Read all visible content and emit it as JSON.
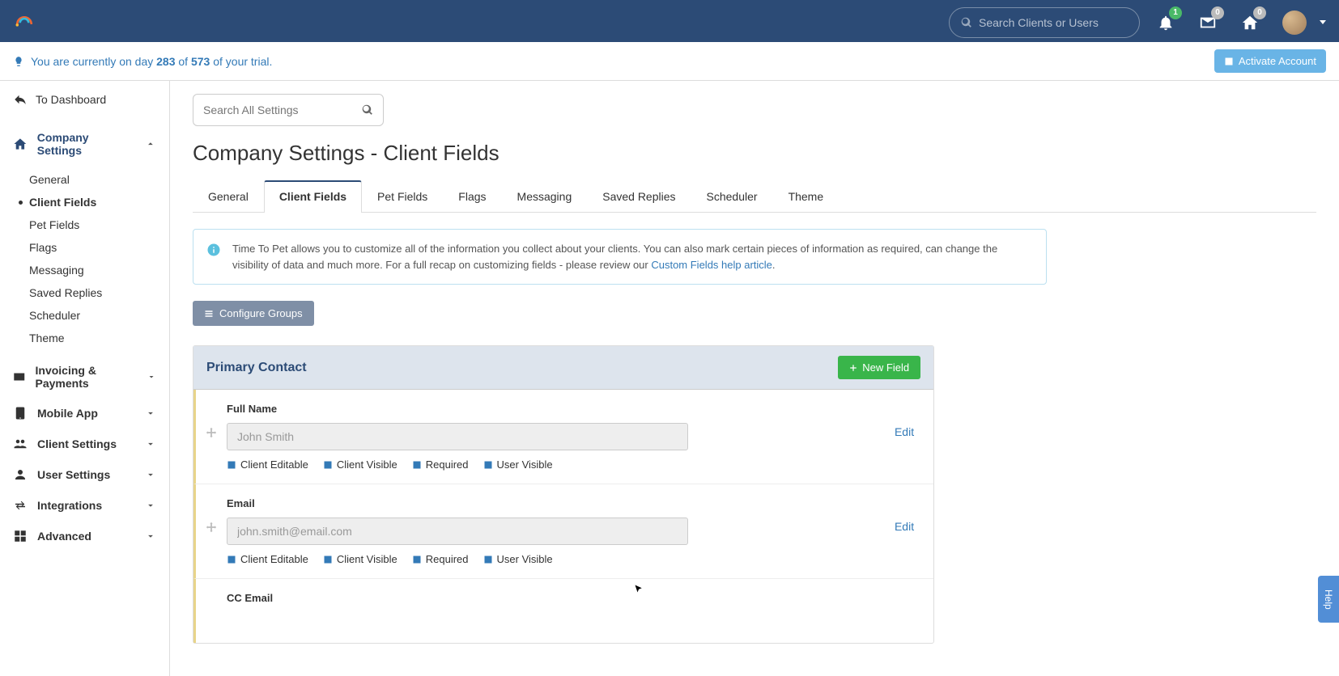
{
  "header": {
    "search_placeholder": "Search Clients or Users",
    "badges": {
      "bell": "1",
      "mail": "0",
      "home": "0"
    }
  },
  "trial": {
    "prefix": "You are currently on day ",
    "day": "283",
    "mid": " of ",
    "total": "573",
    "suffix": " of your trial.",
    "activate_label": "Activate Account"
  },
  "sidebar": {
    "back": "To Dashboard",
    "items": [
      {
        "label": "Company Settings",
        "expanded": true,
        "sub": [
          {
            "label": "General"
          },
          {
            "label": "Client Fields",
            "active": true
          },
          {
            "label": "Pet Fields"
          },
          {
            "label": "Flags"
          },
          {
            "label": "Messaging"
          },
          {
            "label": "Saved Replies"
          },
          {
            "label": "Scheduler"
          },
          {
            "label": "Theme"
          }
        ]
      },
      {
        "label": "Invoicing & Payments"
      },
      {
        "label": "Mobile App"
      },
      {
        "label": "Client Settings"
      },
      {
        "label": "User Settings"
      },
      {
        "label": "Integrations"
      },
      {
        "label": "Advanced"
      }
    ]
  },
  "main": {
    "search_placeholder": "Search All Settings",
    "title": "Company Settings - Client Fields",
    "tabs": [
      "General",
      "Client Fields",
      "Pet Fields",
      "Flags",
      "Messaging",
      "Saved Replies",
      "Scheduler",
      "Theme"
    ],
    "active_tab": "Client Fields",
    "info_text": "Time To Pet allows you to customize all of the information you collect about your clients. You can also mark certain pieces of information as required, can change the visibility of data and much more. For a full recap on customizing fields - please review our ",
    "info_link": "Custom Fields help article",
    "info_period": ".",
    "configure_groups": "Configure Groups",
    "panel": {
      "title": "Primary Contact",
      "new_field": "New Field",
      "fields": [
        {
          "label": "Full Name",
          "placeholder": "John Smith",
          "checks": [
            "Client Editable",
            "Client Visible",
            "Required",
            "User Visible"
          ],
          "edit": "Edit"
        },
        {
          "label": "Email",
          "placeholder": "john.smith@email.com",
          "checks": [
            "Client Editable",
            "Client Visible",
            "Required",
            "User Visible"
          ],
          "edit": "Edit"
        },
        {
          "label": "CC Email"
        }
      ]
    }
  },
  "help": "Help"
}
